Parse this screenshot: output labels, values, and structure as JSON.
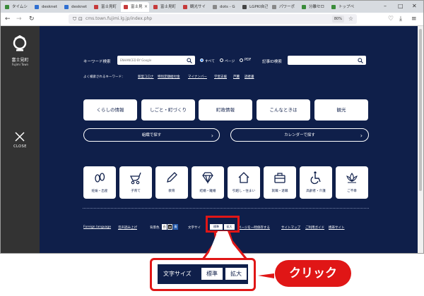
{
  "browser": {
    "tabs": [
      {
        "label": "タイムシ",
        "color": "#3a8c3a"
      },
      {
        "label": "desknet",
        "color": "#2f6fd1"
      },
      {
        "label": "desknet",
        "color": "#2f6fd1"
      },
      {
        "label": "富士見町",
        "color": "#c63a3a"
      },
      {
        "label": "富士見",
        "color": "#c63a3a"
      },
      {
        "label": "富士見町",
        "color": "#c63a3a"
      },
      {
        "label": "観光サイ",
        "color": "#c63a3a"
      },
      {
        "label": "dots - G",
        "color": "#888888"
      },
      {
        "label": "LGPKI自己",
        "color": "#444444"
      },
      {
        "label": "パワーポ",
        "color": "#888888"
      },
      {
        "label": "分離セロ",
        "color": "#3a8c3a"
      },
      {
        "label": "トップペ",
        "color": "#3a8c3a"
      }
    ],
    "url": "cms.town.fujimi.lg.jp/index.php",
    "zoom": "80%"
  },
  "sidebar": {
    "logo_title": "富士見町",
    "logo_sub": "Fujimi Town",
    "close_label": "CLOSE"
  },
  "search": {
    "keyword_label": "キーワード検索",
    "placeholder": "ENHANCED BY Google",
    "radio_options": [
      "すべて",
      "ページ",
      "PDF"
    ],
    "id_label": "記事ID検索"
  },
  "frequent": {
    "label": "よく検索されるキーワード：",
    "keywords": [
      "新型コロナ",
      "特別定額給付金",
      "マイナンバー",
      "学習支援",
      "芦麓",
      "読者書"
    ]
  },
  "categories": [
    "くらしの情報",
    "しごと・町づくり",
    "町政情報",
    "こんなときは",
    "観光"
  ],
  "wide_buttons": [
    "組織で探す",
    "カレンダーで探す"
  ],
  "life_events": [
    "妊娠・出産",
    "子育て",
    "教育",
    "結婚・離婚",
    "引越し・住まい",
    "就職・退職",
    "高齢者・介護",
    "ご不幸"
  ],
  "footer": {
    "foreign": "Foreign language",
    "read_aloud": "音声読み上げ",
    "bg_label": "背景色",
    "bg_options": [
      "白",
      "黒",
      "青"
    ],
    "font_label": "文字サイ",
    "font_options": [
      "標準",
      "拡大"
    ],
    "links": [
      "ページを一時保存する",
      "サイトマップ",
      "ご利用ガイド",
      "携帯サイト"
    ]
  },
  "callout": {
    "label": "文字サイズ",
    "options": [
      "標準",
      "拡大"
    ],
    "bubble": "クリック"
  }
}
